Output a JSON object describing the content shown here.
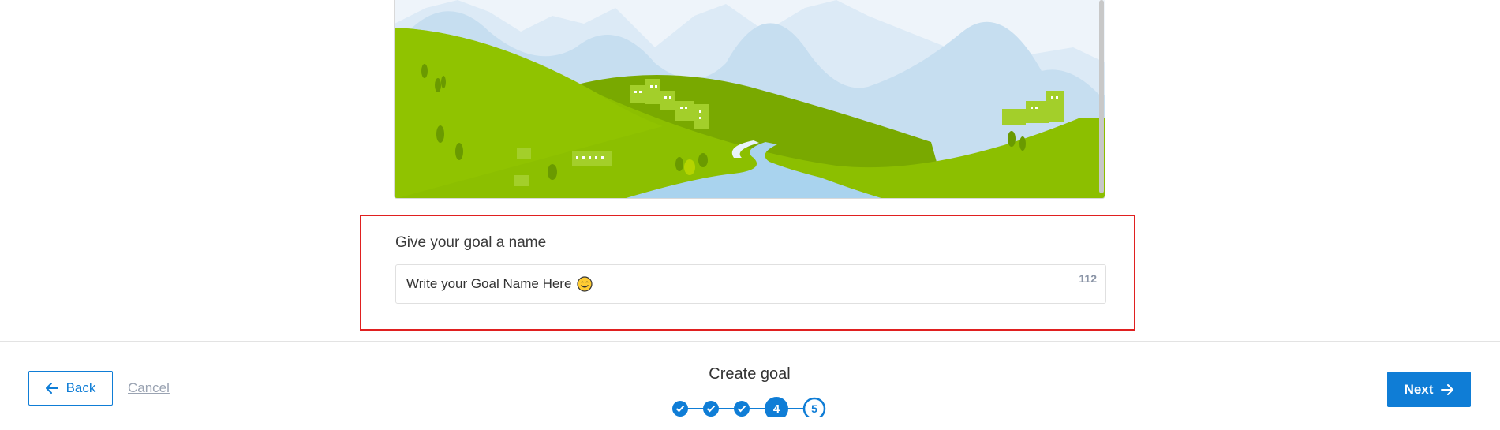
{
  "goal_name": {
    "label": "Give your goal a name",
    "input_value": "Write your Goal Name Here",
    "char_count": "112"
  },
  "footer": {
    "back_label": "Back",
    "cancel_label": "Cancel",
    "title": "Create goal",
    "next_label": "Next",
    "steps": [
      {
        "label": "",
        "state": "completed"
      },
      {
        "label": "",
        "state": "completed"
      },
      {
        "label": "",
        "state": "completed"
      },
      {
        "label": "4",
        "state": "current"
      },
      {
        "label": "5",
        "state": "upcoming"
      }
    ]
  },
  "colors": {
    "primary": "#0f7dd6",
    "highlight_border": "#e02020",
    "hill_green": "#8cbf00",
    "sky": "#eef4fa"
  },
  "icons": {
    "back": "arrow-left-icon",
    "next": "arrow-right-icon",
    "emoji": "smiling-face-icon",
    "step_done": "check-icon"
  }
}
